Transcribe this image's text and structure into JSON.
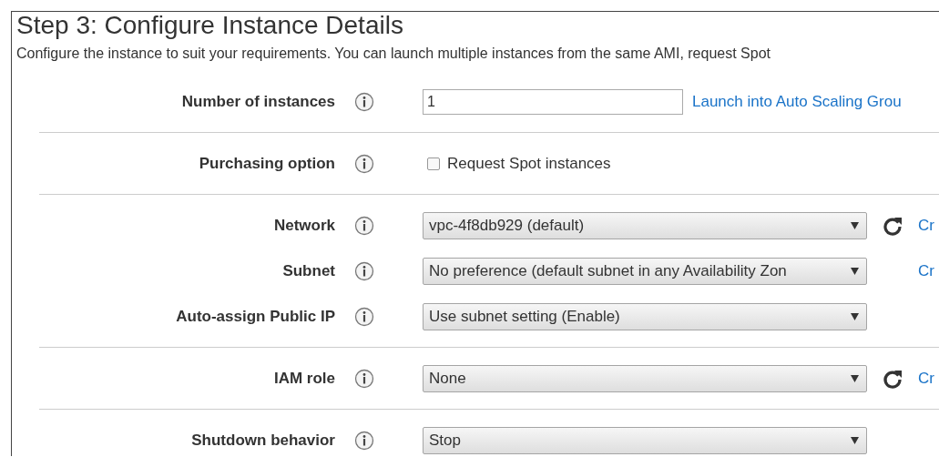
{
  "title": "Step 3: Configure Instance Details",
  "description": "Configure the instance to suit your requirements. You can launch multiple instances from the same AMI, request Spot",
  "sections": [
    {
      "rows": [
        {
          "label": "Number of instances",
          "kind": "input",
          "value": "1",
          "link": "Launch into Auto Scaling Grou"
        }
      ]
    },
    {
      "rows": [
        {
          "label": "Purchasing option",
          "kind": "checkbox",
          "checked": false,
          "text": "Request Spot instances"
        }
      ]
    },
    {
      "rows": [
        {
          "label": "Network",
          "kind": "select",
          "value": "vpc-4f8db929 (default)",
          "refresh": true,
          "link": "Cr"
        },
        {
          "label": "Subnet",
          "kind": "select",
          "value": "No preference (default subnet in any Availability Zon",
          "refresh": false,
          "link": "Cr"
        },
        {
          "label": "Auto-assign Public IP",
          "kind": "select",
          "value": "Use subnet setting (Enable)",
          "refresh": false
        }
      ]
    },
    {
      "rows": [
        {
          "label": "IAM role",
          "kind": "select",
          "value": "None",
          "refresh": true,
          "link": "Cr"
        }
      ]
    },
    {
      "rows": [
        {
          "label": "Shutdown behavior",
          "kind": "select",
          "value": "Stop",
          "refresh": false
        }
      ]
    }
  ]
}
